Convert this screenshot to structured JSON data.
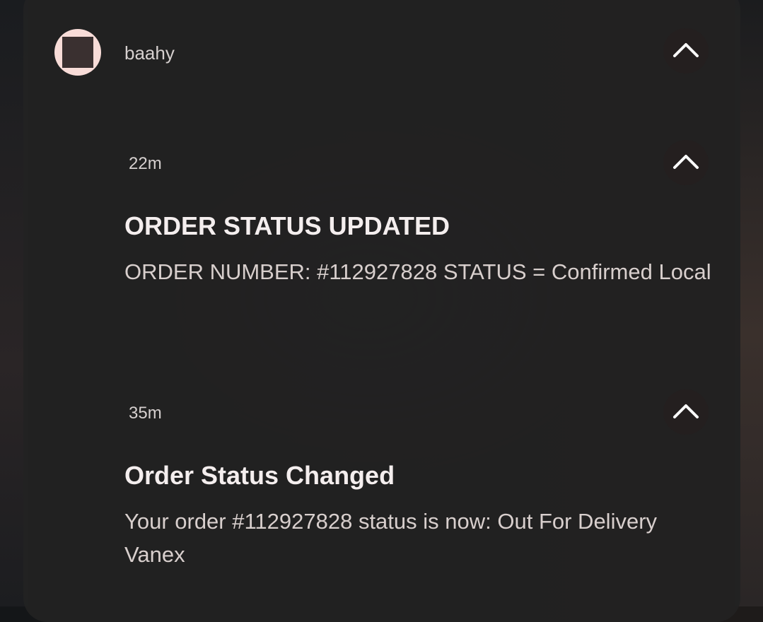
{
  "app": {
    "name": "baahy",
    "icon": "app-square-icon"
  },
  "notifications": [
    {
      "time": "22m",
      "title": "ORDER STATUS UPDATED",
      "body": "ORDER NUMBER: #112927828 STATUS = Confirmed Local"
    },
    {
      "time": "35m",
      "title": "Order Status Changed",
      "body": "Your order #112927828 status is now: Out For Delivery Vanex"
    }
  ],
  "icons": {
    "collapse": "chevron-up-icon"
  },
  "colors": {
    "card": "#222222",
    "avatar_bg": "#f8dcd8",
    "text_primary": "#f4eeee",
    "text_secondary": "#d6d0cf"
  }
}
